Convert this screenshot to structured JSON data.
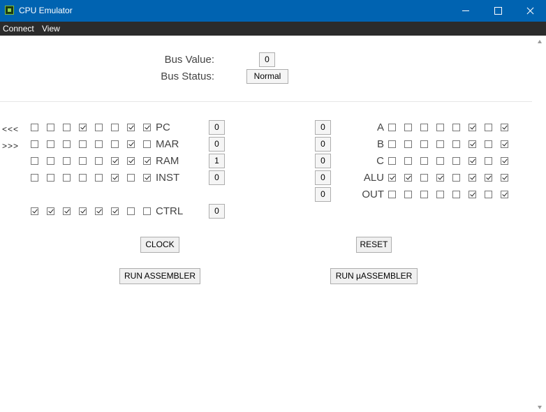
{
  "window": {
    "title": "CPU Emulator"
  },
  "menu": [
    "Connect",
    "View"
  ],
  "bus": {
    "value_label": "Bus Value:",
    "value": "0",
    "status_label": "Bus Status:",
    "status": "Normal"
  },
  "shift": {
    "left": "<<<",
    "right": ">>>"
  },
  "left_registers": [
    {
      "name": "PC",
      "bits": [
        0,
        0,
        0,
        1,
        0,
        0,
        1,
        1
      ],
      "value": "0"
    },
    {
      "name": "MAR",
      "bits": [
        0,
        0,
        0,
        0,
        0,
        0,
        1,
        0
      ],
      "value": "0"
    },
    {
      "name": "RAM",
      "bits": [
        0,
        0,
        0,
        0,
        0,
        1,
        1,
        1
      ],
      "value": "1"
    },
    {
      "name": "INST",
      "bits": [
        0,
        0,
        0,
        0,
        0,
        1,
        0,
        1
      ],
      "value": "0"
    },
    {
      "name": "CTRL",
      "bits": [
        1,
        1,
        1,
        1,
        1,
        1,
        0,
        0
      ],
      "value": "0"
    }
  ],
  "right_registers": [
    {
      "name": "A",
      "bits": [
        0,
        0,
        0,
        0,
        0,
        1,
        0,
        1
      ]
    },
    {
      "name": "B",
      "bits": [
        0,
        0,
        0,
        0,
        0,
        1,
        0,
        1
      ]
    },
    {
      "name": "C",
      "bits": [
        0,
        0,
        0,
        0,
        0,
        1,
        0,
        1
      ]
    },
    {
      "name": "ALU",
      "bits": [
        1,
        1,
        0,
        1,
        0,
        1,
        1,
        1
      ]
    },
    {
      "name": "OUT",
      "bits": [
        0,
        0,
        0,
        0,
        0,
        1,
        0,
        1
      ]
    }
  ],
  "right_values": [
    "0",
    "0",
    "0",
    "0",
    "0"
  ],
  "buttons": {
    "clock": "CLOCK",
    "reset": "RESET",
    "run_asm": "RUN ASSEMBLER",
    "run_uasm": "RUN µASSEMBLER"
  }
}
